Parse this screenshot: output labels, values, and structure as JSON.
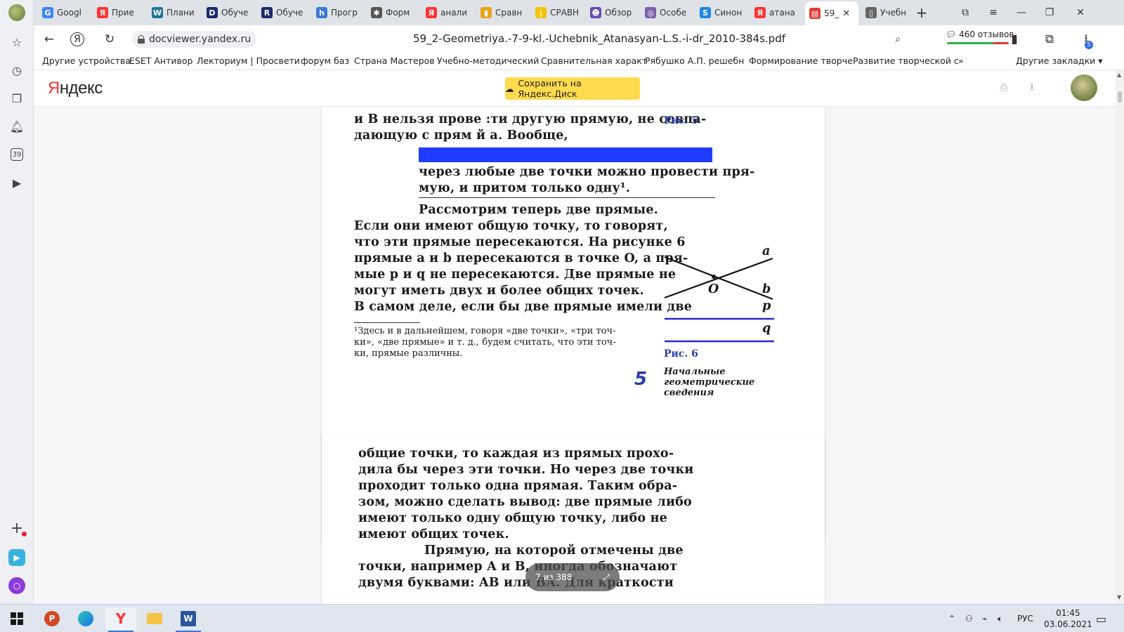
{
  "tabs": [
    {
      "label": "Googl",
      "favicon": "google-icon",
      "color": "#4285f4",
      "glyph": "G"
    },
    {
      "label": "Прие",
      "favicon": "yandex-icon",
      "color": "#f33",
      "glyph": "Я"
    },
    {
      "label": "Плани",
      "favicon": "wordpress-icon",
      "color": "#21759b",
      "glyph": "W"
    },
    {
      "label": "Обуче",
      "favicon": "d-icon",
      "color": "#1a2a6c",
      "glyph": "D"
    },
    {
      "label": "Обуче",
      "favicon": "r-icon",
      "color": "#1a2a6c",
      "glyph": "R"
    },
    {
      "label": "Прогр",
      "favicon": "hf-icon",
      "color": "#3a7bd5",
      "glyph": "h"
    },
    {
      "label": "Форм",
      "favicon": "spider-icon",
      "color": "#555",
      "glyph": "✱"
    },
    {
      "label": "анали",
      "favicon": "yandex-icon",
      "color": "#f33",
      "glyph": "Я"
    },
    {
      "label": "Сравн",
      "favicon": "chart-icon",
      "color": "#e8a317",
      "glyph": "▮"
    },
    {
      "label": "СРАВН",
      "favicon": "stripe-icon",
      "color": "#f5c400",
      "glyph": "|"
    },
    {
      "label": "Обзор",
      "favicon": "user-icon",
      "color": "#6a4bb0",
      "glyph": "☻"
    },
    {
      "label": "Особе",
      "favicon": "circle-icon",
      "color": "#7b5ea7",
      "glyph": "◎"
    },
    {
      "label": "Синон",
      "favicon": "s-icon",
      "color": "#1e88e5",
      "glyph": "S"
    },
    {
      "label": "атана",
      "favicon": "yandex-icon",
      "color": "#f33",
      "glyph": "Я"
    },
    {
      "label": "59_",
      "favicon": "pdf-icon",
      "color": "#e53935",
      "glyph": "▤",
      "active": true
    },
    {
      "label": "Учебн",
      "favicon": "doc-icon",
      "color": "#666",
      "glyph": "▯"
    }
  ],
  "nav": {
    "url": "docviewer.yandex.ru",
    "doc_title": "59_2-Geometriya.-7-9-kl.-Uchebnik_Atanasyan-L.S.-i-dr_2010-384s.pdf",
    "reviews": "460 отзывов",
    "extensions_badge": "5"
  },
  "bookmarks": [
    "Другие устройства",
    "ESET Антивор",
    "Лекториум | Просвети",
    "форум баз",
    "Страна Мастеров",
    "Учебно-методический",
    "Сравнительная характ",
    "Рябушко А.П. решебн",
    "Формирование творче",
    "Развитие творческой с",
    "»",
    "Другие закладки ▾"
  ],
  "header": {
    "logo_ya": "Я",
    "logo_rest": "ндекс",
    "save_button": "Сохранить на Яндекс.Диск"
  },
  "sidebar": {
    "notifications_count": "39"
  },
  "page1": {
    "lines_top": [
      "и B нельзя прове :ти другую прямую, не совпа-",
      "дающую с прям  й a. Вообще,"
    ],
    "axiom": [
      "через любые две точки можно провести пря-",
      "мую, и притом только одну¹."
    ],
    "paragraph": [
      "Рассмотрим теперь две прямые.",
      "Если они имеют общую точку, то говорят,",
      "что эти прямые пересекаются. На рисунке 6",
      "прямые a и b пересекаются в точке O, а пря-",
      "мые p и q не пересекаются. Две прямые не",
      "могут иметь двух и более общих точек.",
      "В самом деле, если бы две прямые имели две"
    ],
    "footnote": [
      "¹Здесь и в дальнейшем, говоря «две точки», «три точ-",
      "ки», «две прямые» и т. д., будем считать, что эти точ-",
      "ки, прямые различны."
    ],
    "fig5_caption": "Рис. 5",
    "fig6_caption": "Рис. 6",
    "fig6_labels": {
      "a": "a",
      "b": "b",
      "o": "O",
      "p": "p",
      "q": "q"
    },
    "page_number": "5",
    "section_title": [
      "Начальные",
      "геометрические",
      "сведения"
    ]
  },
  "page2": {
    "lines": [
      "общие точки, то каждая из прямых прохо-",
      "дила бы через эти точки. Но через две точки",
      "проходит только одна прямая. Таким обра-",
      "зом, можно сделать вывод: две прямые либо",
      "имеют только одну общую точку, либо не",
      "имеют общих точек.",
      "Прямую, на которой отмечены две",
      "точки, например A и B, иногда обозначают",
      "двумя буквами: AB или BA. Для краткости"
    ]
  },
  "pager": {
    "label": "7 из 388"
  },
  "taskbar": {
    "language": "РУС",
    "time": "01:45",
    "date": "03.06.2021"
  }
}
